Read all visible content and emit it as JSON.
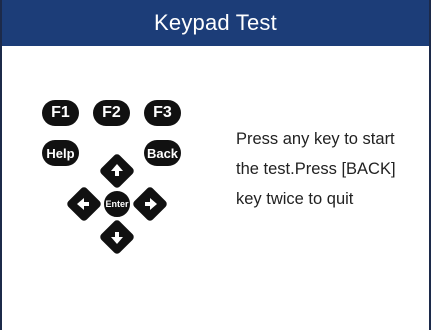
{
  "header": {
    "title": "Keypad Test"
  },
  "keypad": {
    "f1": "F1",
    "f2": "F2",
    "f3": "F3",
    "help": "Help",
    "back": "Back",
    "enter": "Enter",
    "arrows": [
      "up-arrow-icon",
      "down-arrow-icon",
      "left-arrow-icon",
      "right-arrow-icon"
    ]
  },
  "instruction": {
    "lines": [
      "Press any key to start",
      "the test.Press [BACK]",
      "key twice to quit"
    ]
  },
  "colors": {
    "title_bar": "#1c3d78",
    "title_text": "#ffffff",
    "key_fill": "#111111",
    "body_text": "#222222"
  }
}
